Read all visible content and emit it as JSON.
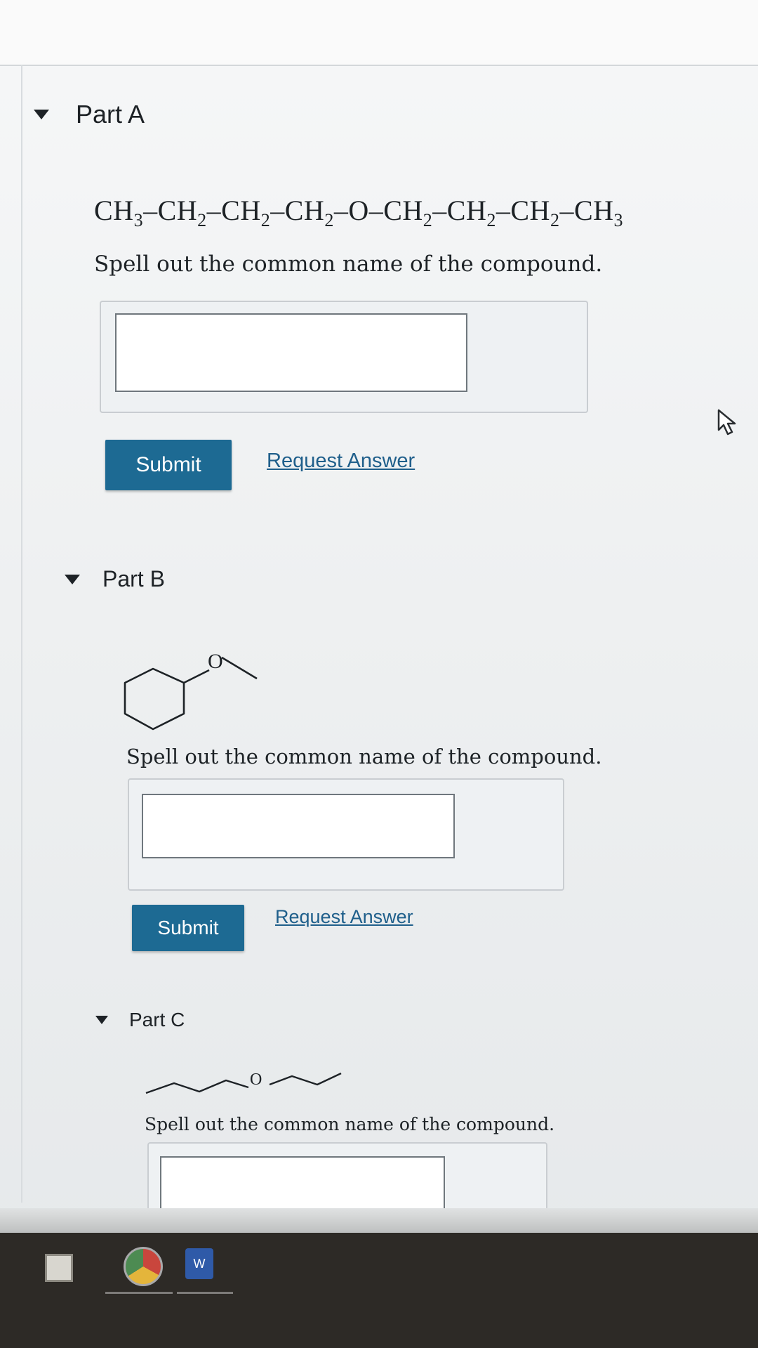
{
  "part_a": {
    "title": "Part A",
    "formula_groups": [
      {
        "base": "CH",
        "sub": "3"
      },
      {
        "base": "CH",
        "sub": "2"
      },
      {
        "base": "CH",
        "sub": "2"
      },
      {
        "base": "CH",
        "sub": "2"
      },
      {
        "base": "O",
        "sub": ""
      },
      {
        "base": "CH",
        "sub": "2"
      },
      {
        "base": "CH",
        "sub": "2"
      },
      {
        "base": "CH",
        "sub": "2"
      },
      {
        "base": "CH",
        "sub": "3"
      }
    ],
    "prompt": "Spell out the common name of the compound.",
    "input_value": "",
    "submit_label": "Submit",
    "request_label": "Request Answer"
  },
  "part_b": {
    "title": "Part B",
    "atom_label": "O",
    "prompt": "Spell out the common name of the compound.",
    "input_value": "",
    "submit_label": "Submit",
    "request_label": "Request Answer"
  },
  "part_c": {
    "title": "Part C",
    "atom_label": "O",
    "prompt": "Spell out the common name of the compound.",
    "input_value": ""
  },
  "colors": {
    "button": "#1d6a93",
    "link": "#1f5f8b",
    "text": "#1d2226"
  },
  "icons": {
    "caret": "caret-down-icon",
    "cursor": "mouse-pointer-icon",
    "taskbar": [
      "start-icon",
      "chrome-icon",
      "word-icon"
    ]
  }
}
